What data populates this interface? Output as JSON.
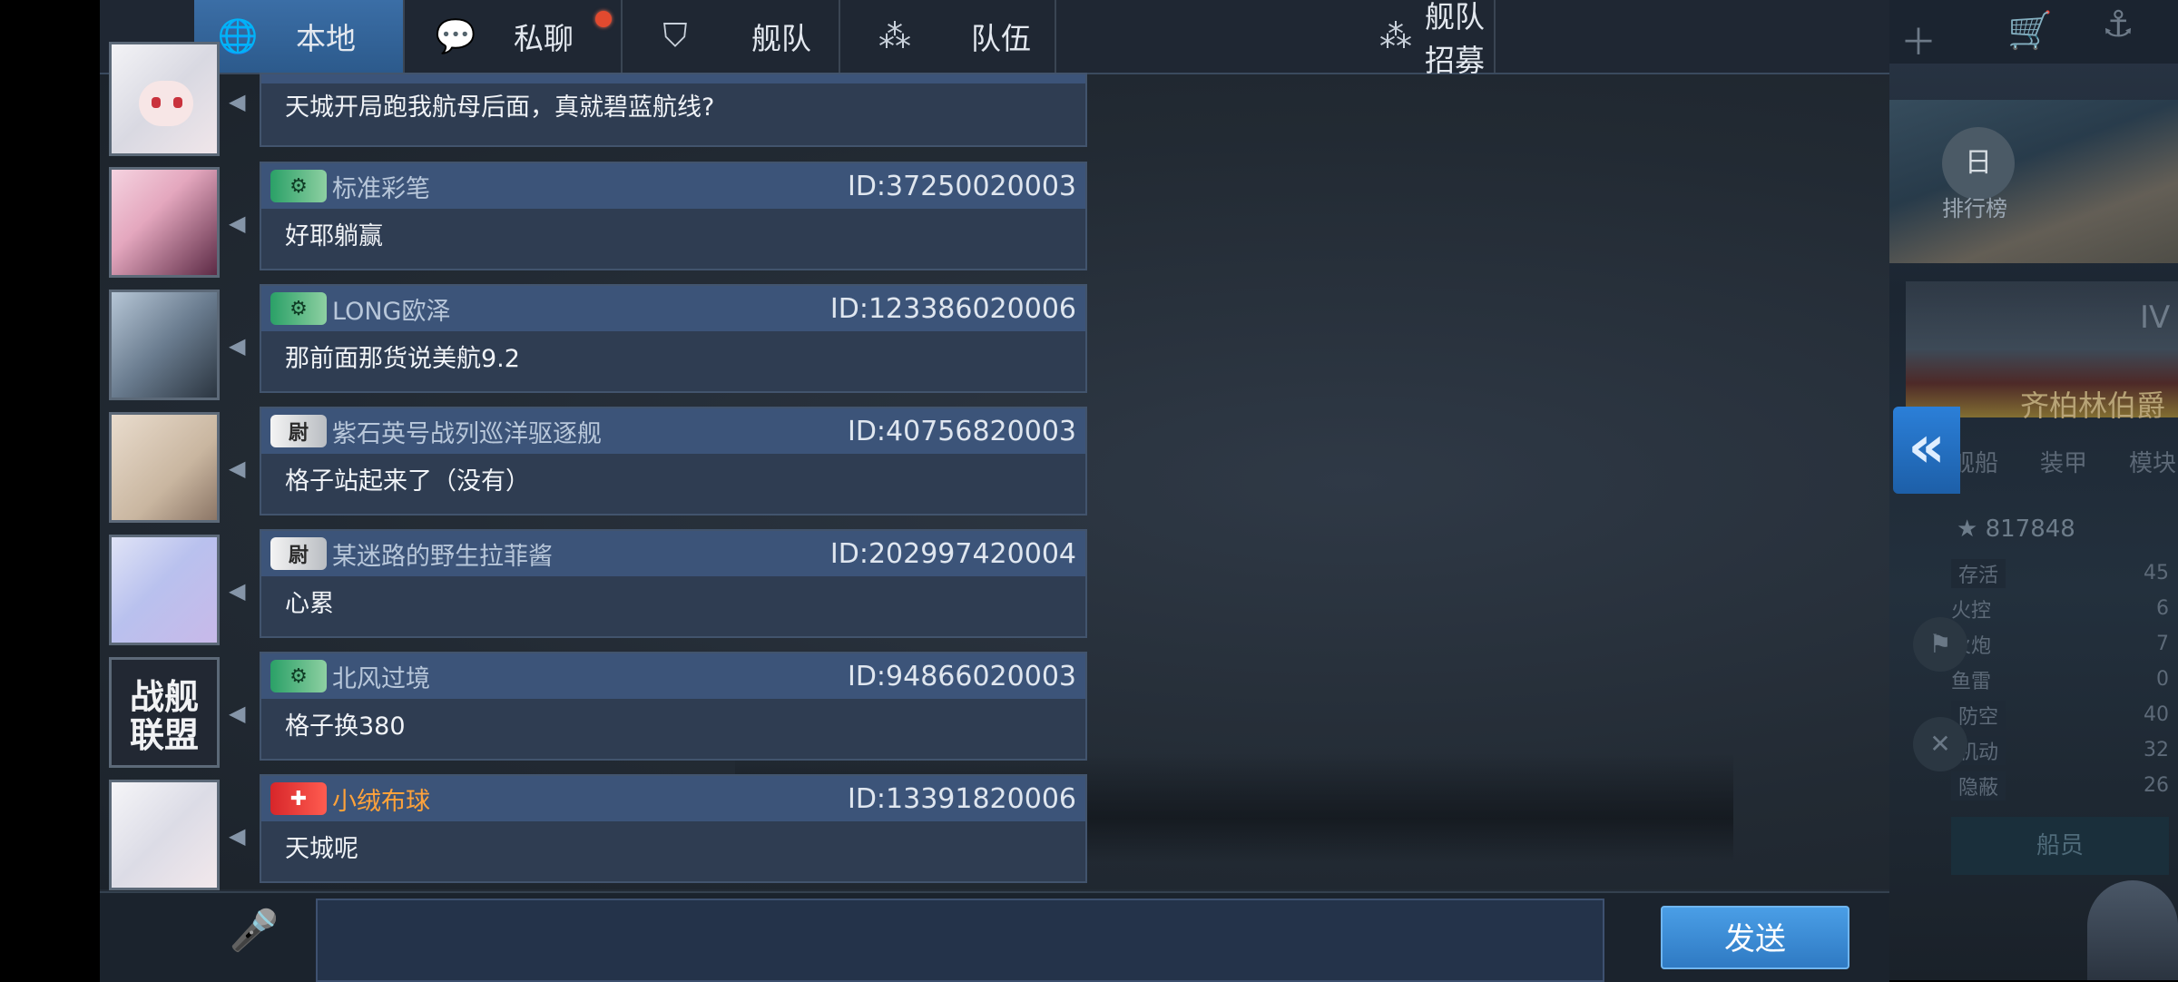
{
  "tabs": [
    {
      "label": "本地",
      "icon": "globe-icon"
    },
    {
      "label": "私聊",
      "icon": "chat-bubble-icon",
      "has_notification": true
    },
    {
      "label": "舰队",
      "icon": "fleet-icon"
    },
    {
      "label": "队伍",
      "icon": "team-icon"
    },
    {
      "label": "舰队招募",
      "icon": "recruit-icon"
    }
  ],
  "active_tab": "本地",
  "messages": [
    {
      "name": "",
      "id": "",
      "text": "天城开局跑我航母后面，真就碧蓝航线?",
      "badge": "none"
    },
    {
      "name": "标准彩笔",
      "id": "ID:37250020003",
      "text": "好耶躺赢",
      "badge": "green"
    },
    {
      "name": "LONG欧泽",
      "id": "ID:123386020006",
      "text": "那前面那货说美航9.2",
      "badge": "green"
    },
    {
      "name": "紫石英号战列巡洋驱逐舰",
      "id": "ID:40756820003",
      "text": "格子站起来了（没有）",
      "badge": "white"
    },
    {
      "name": "某迷路的野生拉菲酱",
      "id": "ID:202997420004",
      "text": "心累",
      "badge": "white"
    },
    {
      "name": "北风过境",
      "id": "ID:94866020003",
      "text": "格子换380",
      "badge": "green"
    },
    {
      "name": "小绒布球",
      "id": "ID:13391820006",
      "text": "天城呢",
      "badge": "red"
    }
  ],
  "avatar_logo": {
    "line1": "战舰",
    "line2": "联盟"
  },
  "composer": {
    "placeholder": "",
    "send_label": "发送"
  },
  "side_panel": {
    "rank_label": "排行榜",
    "tier": "IV",
    "ship_name": "齐柏林伯爵",
    "tabs": [
      "舰船",
      "装甲",
      "模块"
    ],
    "score": "817848",
    "stats": [
      {
        "label": "存活",
        "value": "45"
      },
      {
        "label": "火控",
        "value": "6"
      },
      {
        "label": "火炮",
        "value": "7"
      },
      {
        "label": "鱼雷",
        "value": "0"
      },
      {
        "label": "防空",
        "value": "40"
      },
      {
        "label": "机动",
        "value": "32"
      },
      {
        "label": "隐蔽",
        "value": "26"
      }
    ],
    "crew_label": "船员"
  },
  "colors": {
    "accent": "#2c5a8c",
    "send": "#2f7ac3",
    "notify": "#e24a2f"
  }
}
